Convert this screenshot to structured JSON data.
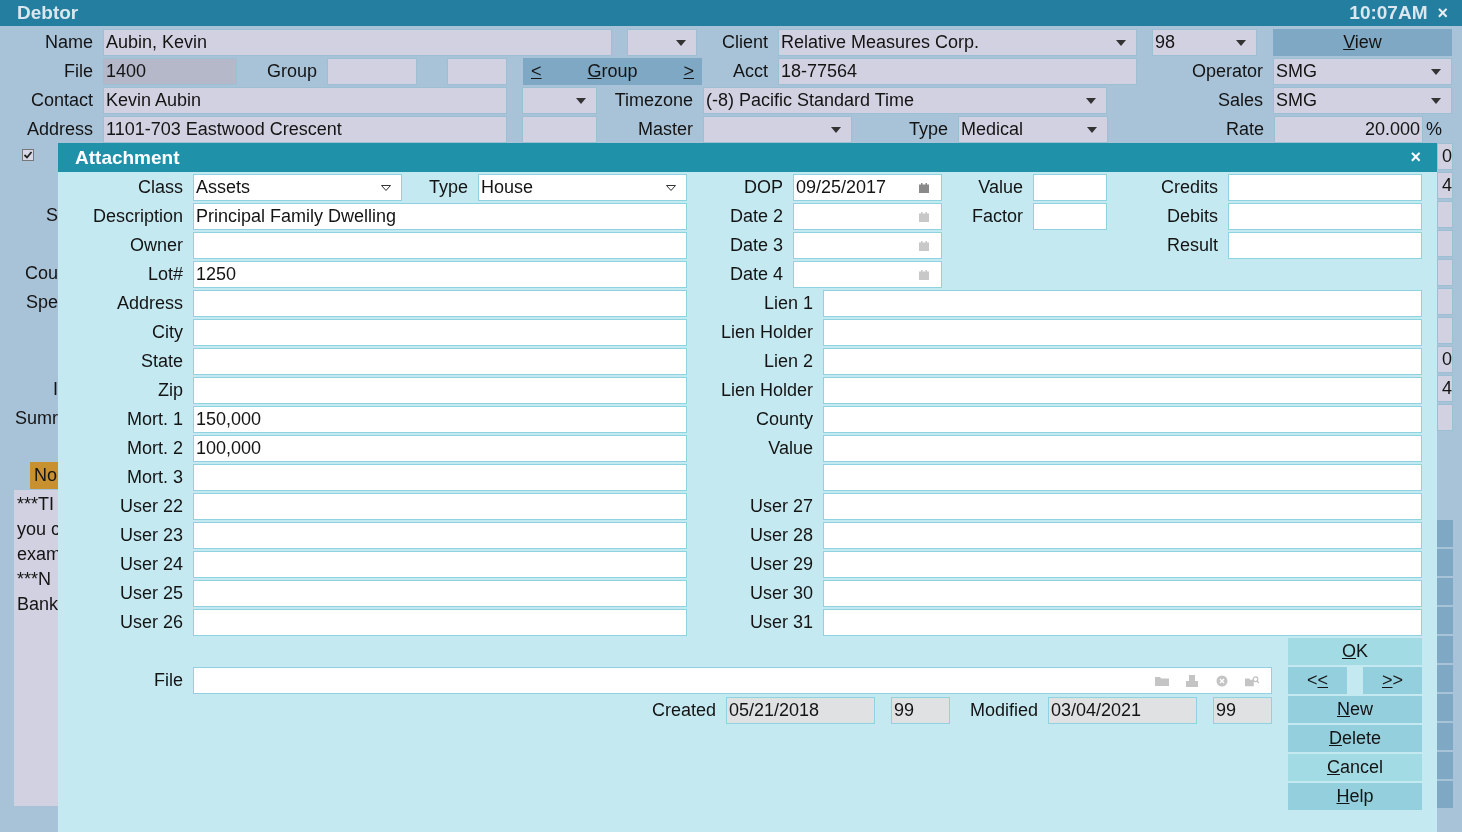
{
  "window": {
    "title": "Debtor",
    "time": "10:07AM",
    "close": "×"
  },
  "debtor": {
    "rows": [
      {
        "fields": [
          {
            "label": "Name",
            "kind": "field",
            "value": "Aubin, Kevin",
            "readonly": false
          },
          {
            "kind": "select"
          },
          {
            "label": "Client",
            "kind": "select",
            "value": "Relative Measures Corp."
          },
          {
            "kind": "select",
            "value": "98"
          },
          {
            "kind": "button",
            "key": "V",
            "after": "iew"
          }
        ]
      },
      {
        "fields": [
          {
            "label": "File",
            "kind": "field",
            "value": "1400",
            "readonly": true
          },
          {
            "label": "Group",
            "kind": "field",
            "readonly": false
          },
          {
            "kind": "field",
            "readonly": false
          },
          {
            "kind": "nav",
            "prev": "<",
            "key": "G",
            "after": "roup",
            "next": ">"
          },
          {
            "label": "Acct",
            "kind": "field",
            "value": "18-77564",
            "readonly": false
          },
          {
            "label": "Operator",
            "kind": "select",
            "value": "SMG"
          }
        ]
      },
      {
        "fields": [
          {
            "label": "Contact",
            "kind": "field",
            "value": "Kevin Aubin",
            "readonly": false
          },
          {
            "kind": "select"
          },
          {
            "label": "Timezone",
            "kind": "select",
            "value": "(-8) Pacific Standard Time"
          },
          {
            "label": "Sales",
            "kind": "select",
            "value": "SMG"
          }
        ]
      },
      {
        "fields": [
          {
            "label": "Address",
            "kind": "field",
            "value": "1101-703 Eastwood Crescent",
            "readonly": false
          },
          {
            "kind": "field",
            "readonly": false
          },
          {
            "label": "Master",
            "kind": "select"
          },
          {
            "label": "Type",
            "kind": "select",
            "value": "Medical"
          },
          {
            "label": "Rate",
            "kind": "number",
            "value": "20.000",
            "unit": "%"
          }
        ]
      }
    ],
    "checkbox": {
      "checked": true
    },
    "hidden_labels": [
      "S",
      "Cou",
      "Spe",
      "I",
      "Sumr"
    ],
    "notes_tab": "No",
    "notes": [
      "***TI",
      "you c",
      "exam",
      "***N",
      "Bank"
    ],
    "right_column": [
      "0",
      "4",
      "0",
      "4"
    ]
  },
  "dialog": {
    "title": "Attachment",
    "close": "×",
    "left_rows": [
      [
        {
          "label": "Class",
          "kind": "select",
          "value": "Assets"
        },
        {
          "label": "Type",
          "kind": "select",
          "value": "House"
        }
      ],
      [
        {
          "label": "Description",
          "kind": "field",
          "value": "Principal Family Dwelling"
        }
      ],
      [
        {
          "label": "Owner",
          "kind": "field"
        }
      ],
      [
        {
          "label": "Lot#",
          "kind": "field",
          "value": "1250"
        }
      ],
      [
        {
          "label": "Address",
          "kind": "field"
        }
      ],
      [
        {
          "label": "City",
          "kind": "field"
        }
      ],
      [
        {
          "label": "State",
          "kind": "field"
        }
      ],
      [
        {
          "label": "Zip",
          "kind": "field"
        }
      ],
      [
        {
          "label": "Mort. 1",
          "kind": "field",
          "value": "150,000"
        }
      ],
      [
        {
          "label": "Mort. 2",
          "kind": "field",
          "value": "100,000"
        }
      ],
      [
        {
          "label": "Mort. 3",
          "kind": "field"
        }
      ],
      [
        {
          "label": "User 22",
          "kind": "field"
        }
      ],
      [
        {
          "label": "User 23",
          "kind": "field"
        }
      ],
      [
        {
          "label": "User 24",
          "kind": "field"
        }
      ],
      [
        {
          "label": "User 25",
          "kind": "field"
        }
      ],
      [
        {
          "label": "User 26",
          "kind": "field"
        }
      ]
    ],
    "date_rows": [
      [
        {
          "label": "DOP",
          "kind": "date",
          "value": "09/25/2017"
        },
        {
          "label": "Value",
          "kind": "short"
        },
        {
          "label": "Credits",
          "kind": "wide"
        }
      ],
      [
        {
          "label": "Date 2",
          "kind": "date"
        },
        {
          "label": "Factor",
          "kind": "short"
        },
        {
          "label": "Debits",
          "kind": "wide"
        }
      ],
      [
        {
          "label": "Date 3",
          "kind": "date"
        },
        {
          "label": "Result",
          "kind": "wide"
        }
      ],
      [
        {
          "label": "Date 4",
          "kind": "date"
        }
      ]
    ],
    "right_rows": [
      {
        "kind": "field",
        "label": "Lien 1"
      },
      {
        "kind": "field",
        "label": "Lien Holder"
      },
      {
        "kind": "field",
        "label": "Lien 2"
      },
      {
        "kind": "field",
        "label": "Lien Holder"
      },
      {
        "kind": "field",
        "label": "County"
      },
      {
        "kind": "field",
        "label": "Value"
      },
      {
        "kind": "field"
      },
      {
        "kind": "field",
        "label": "User 27"
      },
      {
        "kind": "field",
        "label": "User 28"
      },
      {
        "kind": "field",
        "label": "User 29"
      },
      {
        "kind": "field",
        "label": "User 30"
      },
      {
        "kind": "field",
        "label": "User 31"
      }
    ],
    "file": {
      "label": "File"
    },
    "record": [
      {
        "kind": "stamp",
        "label": "Created",
        "value": "05/21/2018"
      },
      {
        "kind": "user",
        "value": "99"
      },
      {
        "kind": "stamp",
        "label": "Modified",
        "value": "03/04/2021"
      },
      {
        "kind": "user",
        "value": "99"
      }
    ],
    "buttons": [
      {
        "kind": "wide",
        "key": "O",
        "after": "K",
        "highlighted": true
      },
      {
        "kind": "half",
        "before": "<",
        "key": "<",
        "highlighted": false
      },
      {
        "kind": "half",
        "key": ">",
        "after": ">",
        "highlighted": false
      },
      {
        "kind": "wide",
        "key": "N",
        "after": "ew",
        "highlighted": false
      },
      {
        "kind": "wide",
        "key": "D",
        "after": "elete",
        "highlighted": false
      },
      {
        "kind": "wide",
        "key": "C",
        "after": "ancel",
        "highlighted": true
      },
      {
        "kind": "wide",
        "key": "H",
        "after": "elp",
        "highlighted": false
      }
    ]
  }
}
